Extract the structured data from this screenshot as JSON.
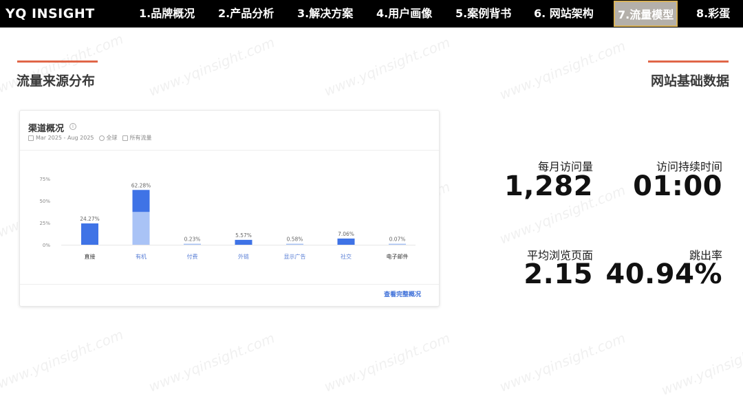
{
  "header": {
    "brand": "YQ INSIGHT",
    "nav": [
      {
        "label": "1.品牌概况",
        "active": false
      },
      {
        "label": "2.产品分析",
        "active": false
      },
      {
        "label": "3.解决方案",
        "active": false
      },
      {
        "label": "4.用户画像",
        "active": false
      },
      {
        "label": "5.案例背书",
        "active": false
      },
      {
        "label": "6. 网站架构",
        "active": false
      },
      {
        "label": "7.流量模型",
        "active": true
      },
      {
        "label": "8.彩蛋",
        "active": false
      }
    ]
  },
  "watermark": "www.yqinsight.com",
  "left_section": {
    "title": "流量来源分布"
  },
  "right_section": {
    "title": "网站基础数据"
  },
  "card": {
    "title": "渠道概况",
    "date_range": "Mar 2025 - Aug 2025",
    "region": "全球",
    "traffic": "所有流量",
    "link": "查看完整概况"
  },
  "colors": {
    "accent": "#e06648",
    "bar_dark": "#3f73e6",
    "bar_light": "#a9c3f6",
    "active_nav": "#b4b0aa"
  },
  "chart_data": {
    "type": "bar",
    "categories": [
      "直接",
      "有机",
      "付费",
      "外链",
      "显示广告",
      "社交",
      "电子邮件"
    ],
    "values": [
      24.27,
      62.28,
      0.23,
      5.57,
      0.58,
      7.06,
      0.07
    ],
    "value_labels": [
      "24.27%",
      "62.28%",
      "0.23%",
      "5.57%",
      "0.58%",
      "7.06%",
      "0.07%"
    ],
    "organic_split": {
      "branded": 25,
      "non_branded": 37.28
    },
    "y_ticks": [
      "75%",
      "50%",
      "25%",
      "0%"
    ],
    "ylim": [
      0,
      75
    ],
    "grid": false
  },
  "metrics": {
    "monthly_visits": {
      "label": "每月访问量",
      "value": "1,282"
    },
    "visit_duration": {
      "label": "访问持续时间",
      "value": "01:00"
    },
    "pages_per_visit": {
      "label": "平均浏览页面",
      "value": "2.15"
    },
    "bounce_rate": {
      "label": "跳出率",
      "value": "40.94%"
    }
  }
}
